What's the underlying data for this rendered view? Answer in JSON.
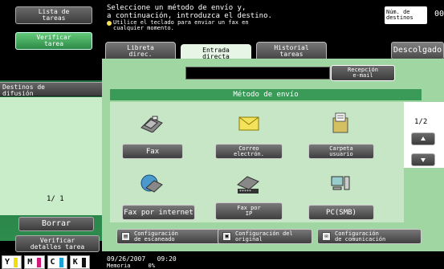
{
  "left": {
    "task_list_label": "Lista de\ntareas",
    "verify_task_label": "Verificar\ntarea",
    "broadcast_label": "Destinos de\ndifusión",
    "counter": "1/ 1",
    "clear_label": "Borrar",
    "verify_details_label": "Verificar\ndetalles tarea",
    "toner": [
      "Y",
      "M",
      "C",
      "K"
    ]
  },
  "header": {
    "instruction_line1": "Seleccione un método de envío y,",
    "instruction_line2": "a continuación, introduzca el destino.",
    "instruction_line3": "Utilice el teclado para enviar un fax en",
    "instruction_line4": "cualquier momento.",
    "dest_count_label": "Núm. de\ndestinos",
    "dest_count_value": "00"
  },
  "tabs": {
    "address_book": "Libreta\ndirec.",
    "direct_input": "Entrada\ndirecta",
    "history": "Historial\ntareas",
    "hang_up": "Descolgado"
  },
  "main": {
    "email_receive_label": "Recepción\ne-mail",
    "method_title": "Método de envío",
    "methods": {
      "fax": "Fax",
      "email": "Correo\nelectrón.",
      "user_box": "Carpeta\nusuario",
      "internet_fax": "Fax por internet",
      "ip_fax": "Fax por\nIP",
      "pc_smb": "PC(SMB)"
    },
    "page_indicator": "1/2",
    "scan_settings": "Configuración\nde escaneado",
    "original_settings": "Configuración del\noriginal",
    "comm_settings": "Configuración\nde comunicación"
  },
  "footer": {
    "datetime": "09/26/2007   09:20",
    "memory_label": "Memoria",
    "memory_value": "0%"
  },
  "colors": {
    "panel_green": "#2f8a4d",
    "main_green": "#9fd6a2",
    "accent_yellow": "#f3e25a"
  }
}
